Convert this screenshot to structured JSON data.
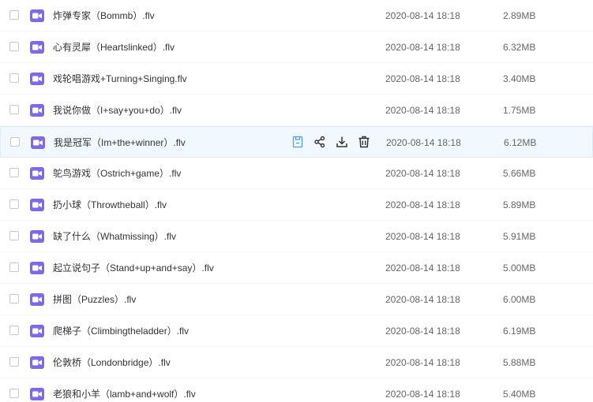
{
  "colors": {
    "accent": "#7e6ae6",
    "hover_row_bg": "#f2f9fe",
    "action_blue": "#4a9ff5",
    "action_dark": "#333333"
  },
  "icons": {
    "file_type": "video-file-icon",
    "actions": [
      "save-icon",
      "share-icon",
      "download-icon",
      "delete-icon"
    ]
  },
  "files": [
    {
      "name": "炸弹专家（Bommb）.flv",
      "date": "2020-08-14 18:18",
      "size": "2.89MB"
    },
    {
      "name": "心有灵犀（Heartslinked）.flv",
      "date": "2020-08-14 18:18",
      "size": "6.32MB"
    },
    {
      "name": "戏轮唱游戏+Turning+Singing.flv",
      "date": "2020-08-14 18:18",
      "size": "3.40MB"
    },
    {
      "name": "我说你做（I+say+you+do）.flv",
      "date": "2020-08-14 18:18",
      "size": "1.75MB"
    },
    {
      "name": "我是冠军（Im+the+winner）.flv",
      "date": "2020-08-14 18:18",
      "size": "6.12MB",
      "hovered": true
    },
    {
      "name": "鸵鸟游戏（Ostrich+game）.flv",
      "date": "2020-08-14 18:18",
      "size": "5.66MB"
    },
    {
      "name": "扔小球（Throwtheball）.flv",
      "date": "2020-08-14 18:18",
      "size": "5.89MB"
    },
    {
      "name": "缺了什么（Whatmissing）.flv",
      "date": "2020-08-14 18:18",
      "size": "5.91MB"
    },
    {
      "name": "起立说句子（Stand+up+and+say）.flv",
      "date": "2020-08-14 18:18",
      "size": "5.00MB"
    },
    {
      "name": "拼图（Puzzles）.flv",
      "date": "2020-08-14 18:18",
      "size": "6.00MB"
    },
    {
      "name": "爬梯子（Climbingtheladder）.flv",
      "date": "2020-08-14 18:18",
      "size": "6.19MB"
    },
    {
      "name": "伦敦桥（Londonbridge）.flv",
      "date": "2020-08-14 18:18",
      "size": "5.88MB"
    },
    {
      "name": "老狼和小羊（lamb+and+wolf）.flv",
      "date": "2020-08-14 18:18",
      "size": "5.40MB"
    }
  ]
}
